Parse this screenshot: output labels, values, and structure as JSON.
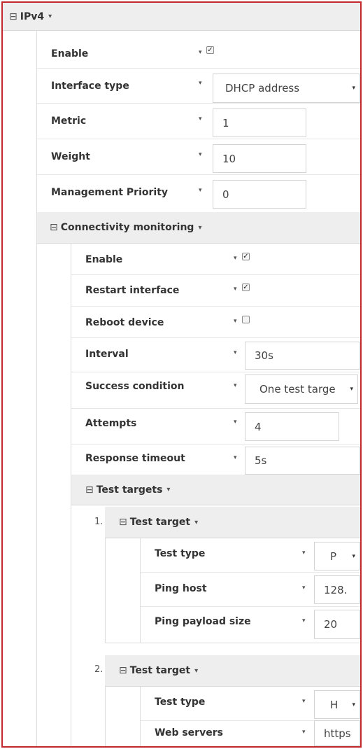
{
  "ipv4": {
    "title": "IPv4",
    "enable_label": "Enable",
    "enable_checked": true,
    "interface_type_label": "Interface type",
    "interface_type_value": "DHCP address",
    "metric_label": "Metric",
    "metric_value": "1",
    "weight_label": "Weight",
    "weight_value": "10",
    "mgmt_priority_label": "Management Priority",
    "mgmt_priority_value": "0"
  },
  "monitoring": {
    "title": "Connectivity monitoring",
    "enable_label": "Enable",
    "enable_checked": true,
    "restart_label": "Restart interface",
    "restart_checked": true,
    "reboot_label": "Reboot device",
    "reboot_checked": false,
    "interval_label": "Interval",
    "interval_value": "30s",
    "success_label": "Success condition",
    "success_value": "One test targe",
    "attempts_label": "Attempts",
    "attempts_value": "4",
    "timeout_label": "Response timeout",
    "timeout_value": "5s"
  },
  "targets": {
    "title": "Test targets",
    "items": [
      {
        "index": "1.",
        "title": "Test target",
        "test_type_label": "Test type",
        "test_type_value": "P",
        "host_label": "Ping host",
        "host_value": "128.",
        "payload_label": "Ping payload size",
        "payload_value": "20"
      },
      {
        "index": "2.",
        "title": "Test target",
        "test_type_label": "Test type",
        "test_type_value": "H",
        "servers_label": "Web servers",
        "servers_value": "https"
      }
    ]
  },
  "icons": {
    "collapse": "⊟",
    "caret": "▾",
    "check": "✓"
  }
}
